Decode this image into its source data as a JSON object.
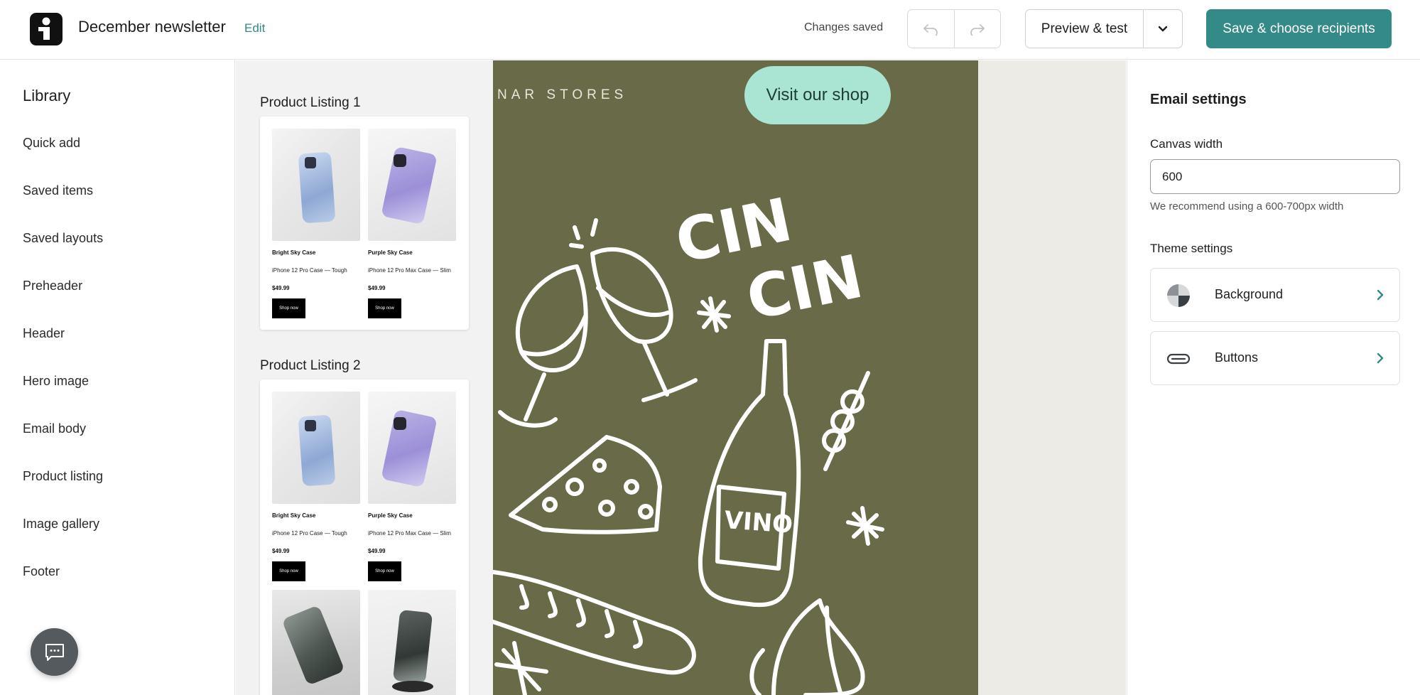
{
  "header": {
    "title": "December newsletter",
    "edit_label": "Edit",
    "status": "Changes saved",
    "preview_label": "Preview & test",
    "save_label": "Save & choose recipients"
  },
  "library": {
    "heading": "Library",
    "items": [
      {
        "label": "Quick add"
      },
      {
        "label": "Saved items"
      },
      {
        "label": "Saved layouts"
      },
      {
        "label": "Preheader"
      },
      {
        "label": "Header"
      },
      {
        "label": "Hero image"
      },
      {
        "label": "Email body"
      },
      {
        "label": "Product listing"
      },
      {
        "label": "Image gallery"
      },
      {
        "label": "Footer"
      }
    ]
  },
  "blocks": [
    {
      "label": "Product Listing 1",
      "products": [
        {
          "name": "Bright Sky Case",
          "desc": "iPhone 12 Pro Case — Tough",
          "price": "$49.99",
          "button": "Shop now"
        },
        {
          "name": "Purple Sky Case",
          "desc": "iPhone 12 Pro Max Case — Slim",
          "price": "$49.99",
          "button": "Shop now"
        }
      ]
    },
    {
      "label": "Product Listing 2",
      "products": [
        {
          "name": "Bright Sky Case",
          "desc": "iPhone 12 Pro Case — Tough",
          "price": "$49.99",
          "button": "Shop now"
        },
        {
          "name": "Purple Sky Case",
          "desc": "iPhone 12 Pro Max Case — Slim",
          "price": "$49.99",
          "button": "Shop now"
        }
      ]
    }
  ],
  "email": {
    "brand": "NAR STORES",
    "cta": "Visit our shop",
    "illustration_text": [
      "CIN",
      "CIN",
      "VINO"
    ],
    "background_color": "#696a48",
    "cta_color": "#a9e5d2"
  },
  "settings": {
    "title": "Email settings",
    "canvas_width_label": "Canvas width",
    "canvas_width_value": "600",
    "canvas_width_hint": "We recommend using a 600-700px width",
    "theme_title": "Theme settings",
    "theme_rows": [
      {
        "label": "Background",
        "icon": "background-icon"
      },
      {
        "label": "Buttons",
        "icon": "button-shape-icon"
      }
    ]
  },
  "colors": {
    "accent": "#338a86",
    "edit_link": "#2f8a87"
  }
}
